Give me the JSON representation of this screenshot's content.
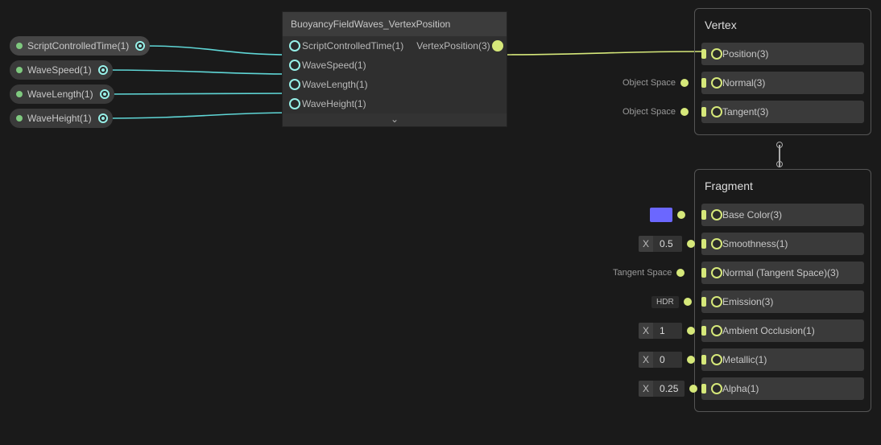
{
  "pills": [
    {
      "label": "ScriptControlledTime(1)"
    },
    {
      "label": "WaveSpeed(1)"
    },
    {
      "label": "WaveLength(1)"
    },
    {
      "label": "WaveHeight(1)"
    }
  ],
  "subnode": {
    "title": "BuoyancyFieldWaves_VertexPosition",
    "inputs": [
      "ScriptControlledTime(1)",
      "WaveSpeed(1)",
      "WaveLength(1)",
      "WaveHeight(1)"
    ],
    "outputs": [
      "VertexPosition(3)"
    ],
    "expand": "⌄"
  },
  "vertex": {
    "title": "Vertex",
    "slots": [
      {
        "label": "Position(3)",
        "ext_type": "none"
      },
      {
        "label": "Normal(3)",
        "ext_type": "space",
        "ext_label": "Object Space"
      },
      {
        "label": "Tangent(3)",
        "ext_type": "space",
        "ext_label": "Object Space"
      }
    ]
  },
  "fragment": {
    "title": "Fragment",
    "slots": [
      {
        "label": "Base Color(3)",
        "ext_type": "color",
        "color": "#6b67ff"
      },
      {
        "label": "Smoothness(1)",
        "ext_type": "x",
        "value": "0.5"
      },
      {
        "label": "Normal (Tangent Space)(3)",
        "ext_type": "space",
        "ext_label": "Tangent Space"
      },
      {
        "label": "Emission(3)",
        "ext_type": "hdr",
        "hdr": "HDR"
      },
      {
        "label": "Ambient Occlusion(1)",
        "ext_type": "x",
        "value": "1"
      },
      {
        "label": "Metallic(1)",
        "ext_type": "x",
        "value": "0"
      },
      {
        "label": "Alpha(1)",
        "ext_type": "x",
        "value": "0.25"
      }
    ]
  }
}
